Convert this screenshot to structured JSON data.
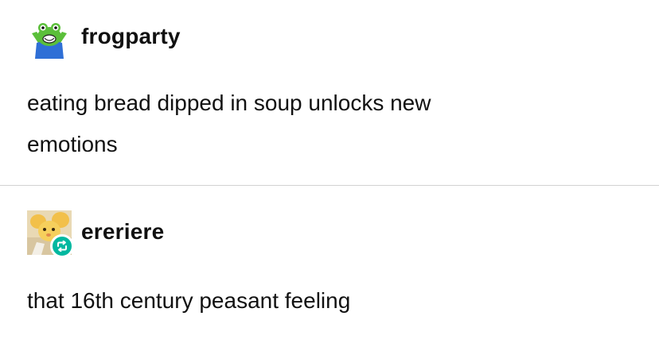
{
  "posts": [
    {
      "username": "frogparty",
      "avatar_icon": "frog-avatar-icon",
      "lines": [
        "eating bread dipped in soup unlocks new",
        "emotions"
      ]
    },
    {
      "username": "ereriere",
      "avatar_icon": "anime-avatar-icon",
      "badge_icon": "reblog-icon",
      "lines": [
        "that 16th century peasant feeling"
      ]
    }
  ],
  "colors": {
    "divider": "#d2d2d2",
    "reblog_badge": "#00b8a0",
    "frog_green": "#5bbf3a",
    "frog_shirt": "#2f6fd6"
  }
}
